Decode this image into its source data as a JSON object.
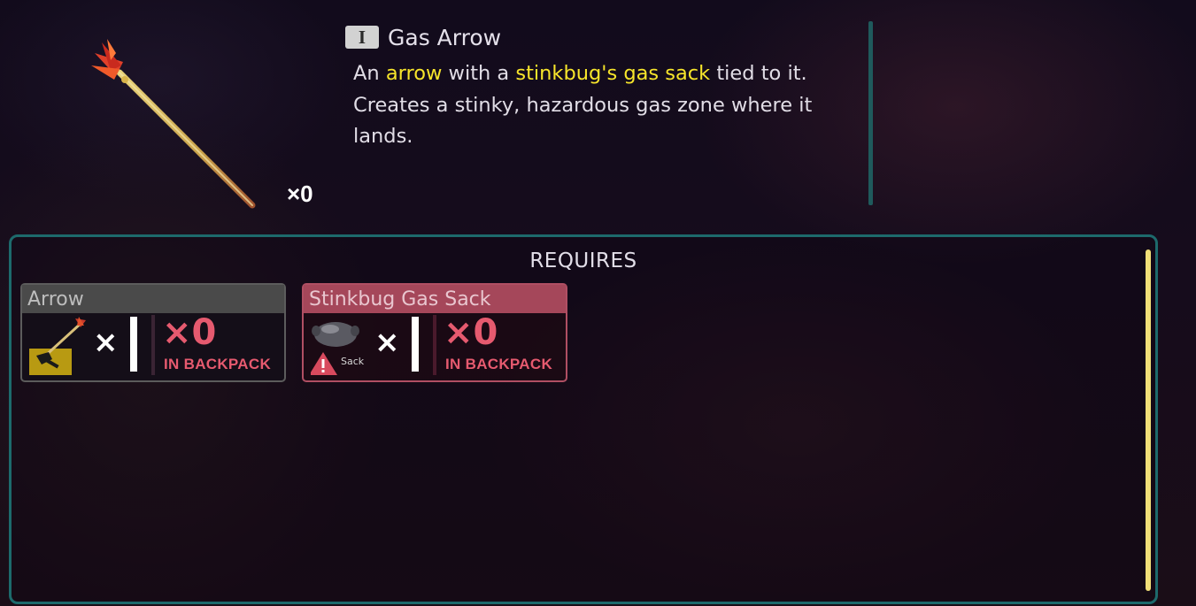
{
  "item": {
    "tier_badge": "I",
    "title": "Gas Arrow",
    "count": "×0",
    "description": {
      "p1": "An ",
      "h1": "arrow",
      "p2": " with a ",
      "h2": "stinkbug's gas sack",
      "p3": " tied to it. Creates a stinky, hazardous gas zone where it lands."
    },
    "highlight_color": "#f7e52b",
    "icon": "gas-arrow-icon"
  },
  "requires": {
    "title": "REQUIRES",
    "ingredients": [
      {
        "name": "Arrow",
        "icon": "arrow-icon",
        "badge_icon": "axe-icon",
        "times": "×",
        "have": "×0",
        "location": "IN BACKPACK",
        "status": "missing",
        "color": "#5c5c5c"
      },
      {
        "name": "Stinkbug Gas Sack",
        "icon": "gas-sack-icon",
        "badge_icon": "warning-icon",
        "icon_label": "Sack",
        "times": "×",
        "have": "×0",
        "location": "IN BACKPACK",
        "status": "missing",
        "color": "#b04f63"
      }
    ]
  },
  "colors": {
    "panel_border": "#1d6a6c",
    "missing_text": "#e65a6f",
    "scrollbar": "#f1df78"
  }
}
